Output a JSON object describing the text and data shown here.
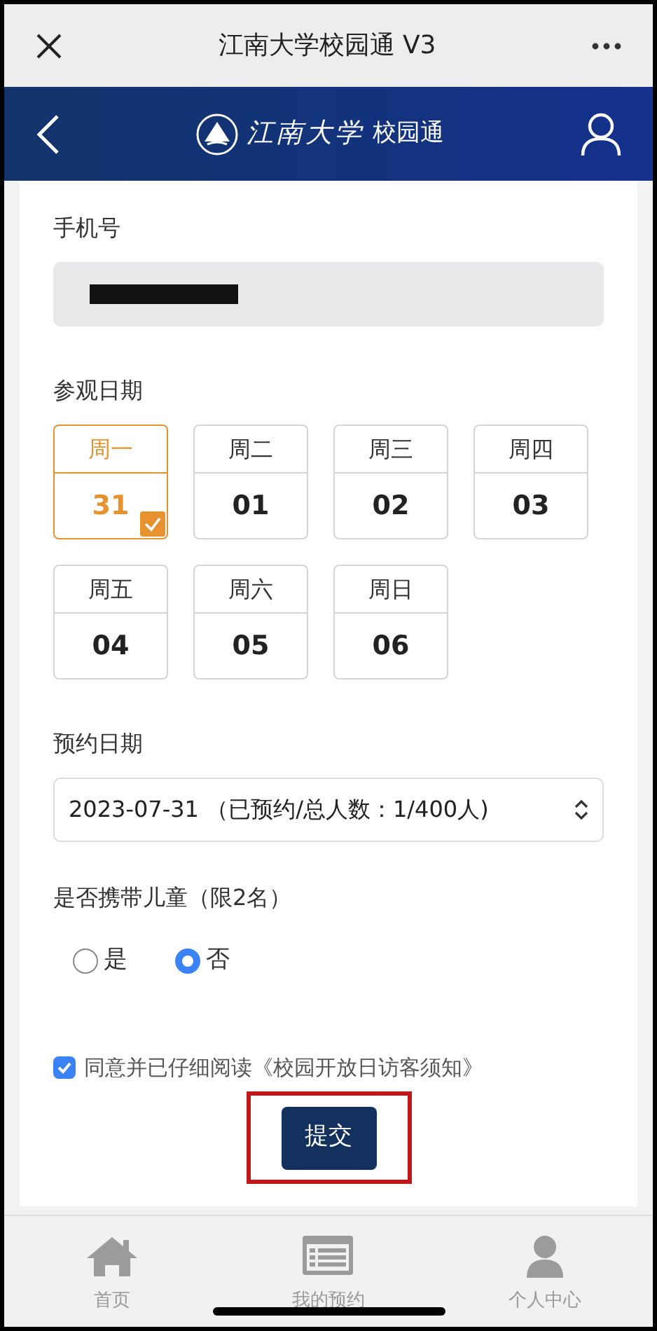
{
  "top_bar": {
    "title": "江南大学校园通 V3"
  },
  "header": {
    "logo_text": "江南大学",
    "app_name": "校园通"
  },
  "phone": {
    "label": "手机号",
    "redacted": true
  },
  "visit_date": {
    "label": "参观日期",
    "days": [
      {
        "weekday": "周一",
        "day": "31",
        "selected": true
      },
      {
        "weekday": "周二",
        "day": "01",
        "selected": false
      },
      {
        "weekday": "周三",
        "day": "02",
        "selected": false
      },
      {
        "weekday": "周四",
        "day": "03",
        "selected": false
      },
      {
        "weekday": "周五",
        "day": "04",
        "selected": false
      },
      {
        "weekday": "周六",
        "day": "05",
        "selected": false
      },
      {
        "weekday": "周日",
        "day": "06",
        "selected": false
      }
    ]
  },
  "booking_date": {
    "label": "预约日期",
    "value": "2023-07-31 （已预约/总人数：1/400人)"
  },
  "children": {
    "label": "是否携带儿童（限2名）",
    "options": [
      {
        "label": "是",
        "selected": false
      },
      {
        "label": "否",
        "selected": true
      }
    ]
  },
  "agreement": {
    "text": "同意并已仔细阅读《校园开放日访客须知》",
    "checked": true
  },
  "submit": {
    "label": "提交",
    "highlighted": true
  },
  "tab_bar": [
    {
      "label": "首页",
      "kind": "home"
    },
    {
      "label": "我的预约",
      "kind": "list"
    },
    {
      "label": "个人中心",
      "kind": "person"
    }
  ]
}
